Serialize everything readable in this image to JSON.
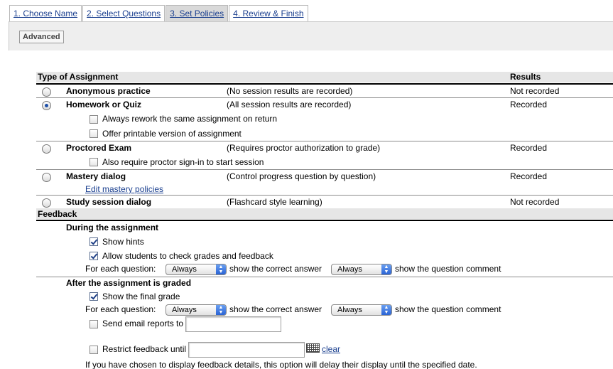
{
  "tabs": [
    {
      "label": "1. Choose Name"
    },
    {
      "label": "2. Select Questions"
    },
    {
      "label": "3. Set Policies",
      "active": true
    },
    {
      "label": "4. Review & Finish"
    }
  ],
  "advanced_label": "Advanced",
  "assignment": {
    "header": "Type of Assignment",
    "results_header": "Results",
    "types": [
      {
        "name": "Anonymous practice",
        "desc": "(No session results are recorded)",
        "result": "Not recorded",
        "selected": false
      },
      {
        "name": "Homework or Quiz",
        "desc": "(All session results are recorded)",
        "result": "Recorded",
        "selected": true
      },
      {
        "name": "Proctored Exam",
        "desc": "(Requires proctor authorization to grade)",
        "result": "Recorded",
        "selected": false
      },
      {
        "name": "Mastery dialog",
        "desc": "(Control progress question by question)",
        "result": "Recorded",
        "selected": false
      },
      {
        "name": "Study session dialog",
        "desc": "(Flashcard style learning)",
        "result": "Not recorded",
        "selected": false
      }
    ],
    "homework_options": [
      {
        "label": "Always rework the same assignment on return",
        "checked": false
      },
      {
        "label": "Offer printable version of assignment",
        "checked": false
      }
    ],
    "proctor_option": {
      "label": "Also require proctor sign-in to start session",
      "checked": false
    },
    "mastery_link": "Edit mastery policies"
  },
  "feedback": {
    "header": "Feedback",
    "during": {
      "title": "During the assignment",
      "options": [
        {
          "label": "Show hints",
          "checked": true
        },
        {
          "label": "Allow students to check grades and feedback",
          "checked": true
        }
      ],
      "per_question_label": "For each question:",
      "answer_select": "Always",
      "answer_label": "show the correct answer",
      "comment_select": "Always",
      "comment_label": "show the question comment"
    },
    "after": {
      "title": "After the assignment is graded",
      "final_grade": {
        "label": "Show the final grade",
        "checked": true
      },
      "per_question_label": "For each question:",
      "answer_select": "Always",
      "answer_label": "show the correct answer",
      "comment_select": "Always",
      "comment_label": "show the question comment",
      "email": {
        "label": "Send email reports to",
        "checked": false,
        "value": ""
      },
      "restrict": {
        "label": "Restrict feedback until",
        "checked": false,
        "value": ""
      },
      "clear_link": "clear",
      "note": "If you have chosen to display feedback details, this option will delay their display until the specified date."
    }
  }
}
